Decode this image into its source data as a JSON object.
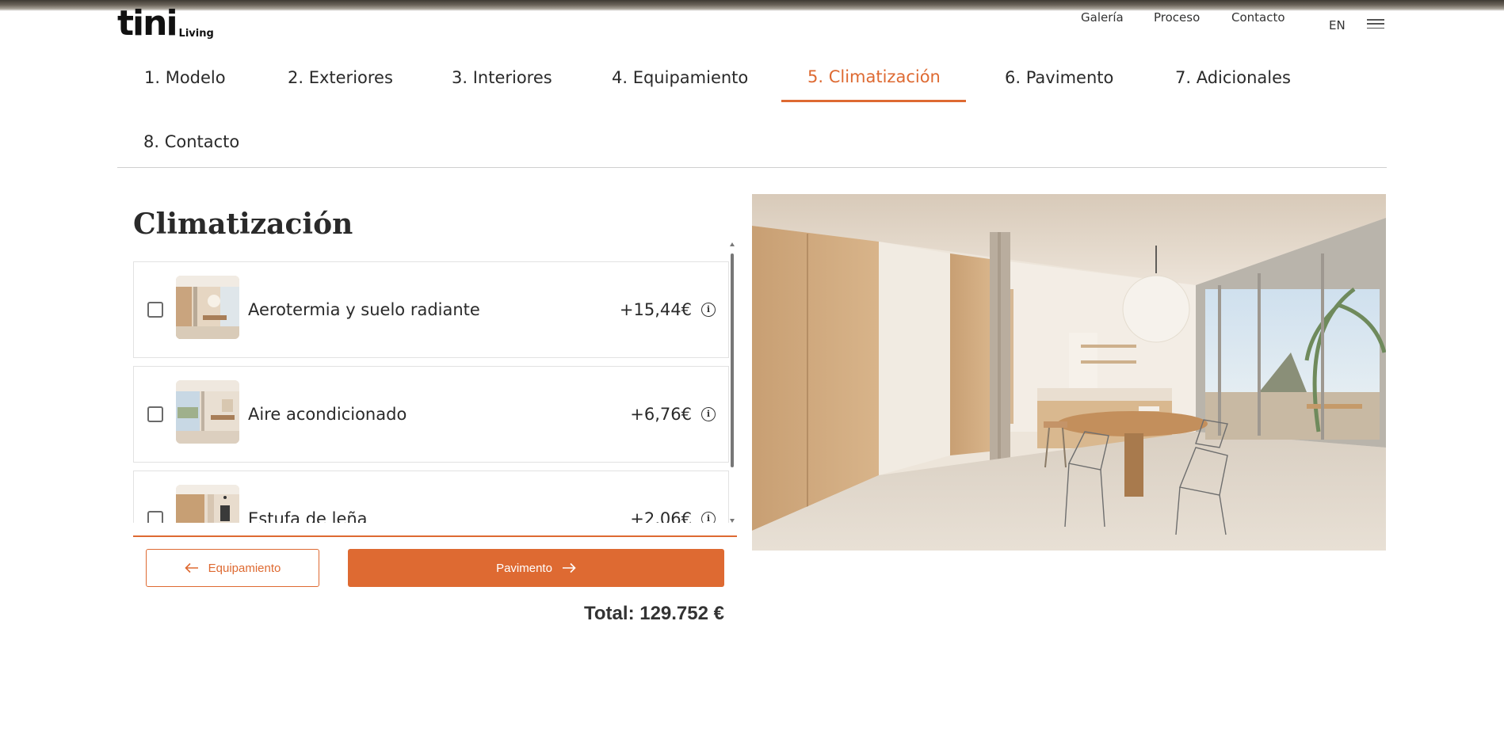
{
  "brand": {
    "logo_main": "tini",
    "logo_sub": "Living"
  },
  "topnav": {
    "links": [
      "Galería",
      "Proceso",
      "Contacto"
    ],
    "language": "EN",
    "menu_icon": "hamburger-menu-icon"
  },
  "steps": [
    {
      "label": "1. Modelo",
      "active": false
    },
    {
      "label": "2. Exteriores",
      "active": false
    },
    {
      "label": "3. Interiores",
      "active": false
    },
    {
      "label": "4. Equipamiento",
      "active": false
    },
    {
      "label": "5. Climatización",
      "active": true
    },
    {
      "label": "6. Pavimento",
      "active": false
    },
    {
      "label": "7. Adicionales",
      "active": false
    },
    {
      "label": "8. Contacto",
      "active": false
    }
  ],
  "panel": {
    "title": "Climatización",
    "options": [
      {
        "label": "Aerotermia y suelo radiante",
        "price": "+15,44€",
        "checked": false,
        "info_icon": "info-icon"
      },
      {
        "label": "Aire acondicionado",
        "price": "+6,76€",
        "checked": false,
        "info_icon": "info-icon"
      },
      {
        "label": "Estufa de leña",
        "price": "+2,06€",
        "checked": false,
        "info_icon": "info-icon"
      }
    ]
  },
  "buttons": {
    "prev_label": "Equipamiento",
    "next_label": "Pavimento"
  },
  "total": {
    "text": "Total: 129.752 €"
  },
  "colors": {
    "accent": "#de6a32",
    "text": "#2a2a2a",
    "border": "#e2e2e2"
  }
}
